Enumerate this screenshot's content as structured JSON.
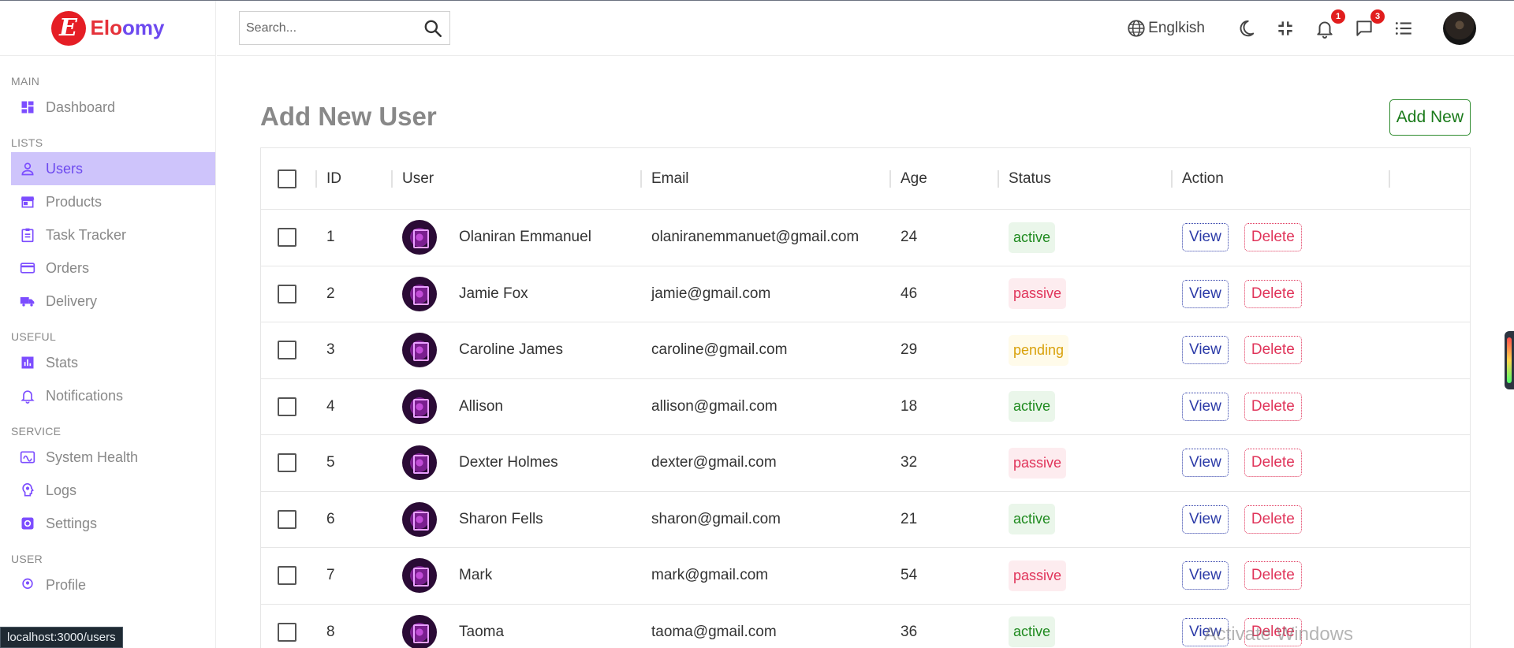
{
  "brand": {
    "prefix": "Elo",
    "suffix": "omy",
    "logo_letter": "E"
  },
  "search": {
    "placeholder": "Search..."
  },
  "topbar": {
    "language": "Englkish",
    "notifications_count": "1",
    "messages_count": "3"
  },
  "sidebar": {
    "sections": [
      {
        "title": "MAIN",
        "items": [
          {
            "label": "Dashboard",
            "icon": "dashboard-icon"
          }
        ]
      },
      {
        "title": "LISTS",
        "items": [
          {
            "label": "Users",
            "icon": "person-icon",
            "active": true
          },
          {
            "label": "Products",
            "icon": "store-icon"
          },
          {
            "label": "Task Tracker",
            "icon": "clipboard-icon"
          },
          {
            "label": "Orders",
            "icon": "credit-card-icon"
          },
          {
            "label": "Delivery",
            "icon": "truck-icon"
          }
        ]
      },
      {
        "title": "USEFUL",
        "items": [
          {
            "label": "Stats",
            "icon": "bar-chart-icon"
          },
          {
            "label": "Notifications",
            "icon": "bell-icon"
          }
        ]
      },
      {
        "title": "SERVICE",
        "items": [
          {
            "label": "System Health",
            "icon": "health-icon"
          },
          {
            "label": "Logs",
            "icon": "psychology-icon"
          },
          {
            "label": "Settings",
            "icon": "settings-icon"
          }
        ]
      },
      {
        "title": "USER",
        "items": [
          {
            "label": "Profile",
            "icon": "profile-icon"
          }
        ]
      }
    ]
  },
  "page": {
    "title": "Add New User",
    "add_button": "Add New"
  },
  "table": {
    "headers": {
      "id": "ID",
      "user": "User",
      "email": "Email",
      "age": "Age",
      "status": "Status",
      "action": "Action"
    },
    "view_label": "View",
    "delete_label": "Delete",
    "rows": [
      {
        "id": "1",
        "name": "Olaniran Emmanuel",
        "email": "olaniranemmanuet@gmail.com",
        "age": "24",
        "status": "active"
      },
      {
        "id": "2",
        "name": "Jamie Fox",
        "email": "jamie@gmail.com",
        "age": "46",
        "status": "passive"
      },
      {
        "id": "3",
        "name": "Caroline James",
        "email": "caroline@gmail.com",
        "age": "29",
        "status": "pending"
      },
      {
        "id": "4",
        "name": "Allison",
        "email": "allison@gmail.com",
        "age": "18",
        "status": "active"
      },
      {
        "id": "5",
        "name": "Dexter Holmes",
        "email": "dexter@gmail.com",
        "age": "32",
        "status": "passive"
      },
      {
        "id": "6",
        "name": "Sharon Fells",
        "email": "sharon@gmail.com",
        "age": "21",
        "status": "active"
      },
      {
        "id": "7",
        "name": "Mark",
        "email": "mark@gmail.com",
        "age": "54",
        "status": "passive"
      },
      {
        "id": "8",
        "name": "Taoma",
        "email": "taoma@gmail.com",
        "age": "36",
        "status": "active"
      }
    ]
  },
  "browser": {
    "status_url": "localhost:3000/users"
  },
  "overlay": {
    "watermark": "Activate Windows"
  },
  "colors": {
    "accent": "#6d4aef",
    "brand_red": "#e5323a",
    "active": "#1f8a1f",
    "passive": "#e0345a",
    "pending": "#d9a10a"
  }
}
